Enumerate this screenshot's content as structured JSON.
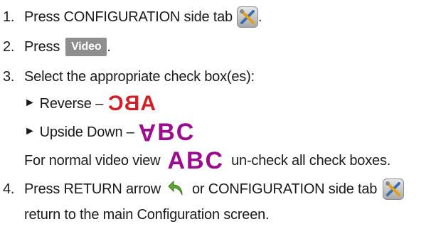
{
  "steps": {
    "s1": {
      "number": "1.",
      "text": "Press CONFIGURATION side tab",
      "suffix": "."
    },
    "s2": {
      "number": "2.",
      "text": "Press",
      "button": "Video",
      "suffix": "."
    },
    "s3": {
      "number": "3.",
      "text": "Select the appropriate check box(es):"
    },
    "s3a": {
      "arrow": "►",
      "text": "Reverse –",
      "sample": "ABC"
    },
    "s3b": {
      "arrow": "►",
      "text": "Upside Down –",
      "sample_a": "A",
      "sample_rest": "BC"
    },
    "s3c": {
      "text_before": "For normal video view",
      "sample": "ABC",
      "text_after": "un-check all check boxes."
    },
    "s4": {
      "number": "4.",
      "text_before": "Press RETURN arrow",
      "text_after": "or CONFIGURATION side tab"
    },
    "s4b": {
      "text": "return to the main Configuration screen."
    }
  },
  "colors": {
    "text": "#1a1a1a",
    "video_button_bg": "#8e8e8e",
    "reverse_red": "#d11f26",
    "normal_purple": "#9b0d8e",
    "return_green": "#5aa832"
  },
  "icons": {
    "config": "tools-icon",
    "return": "return-arrow-icon"
  }
}
